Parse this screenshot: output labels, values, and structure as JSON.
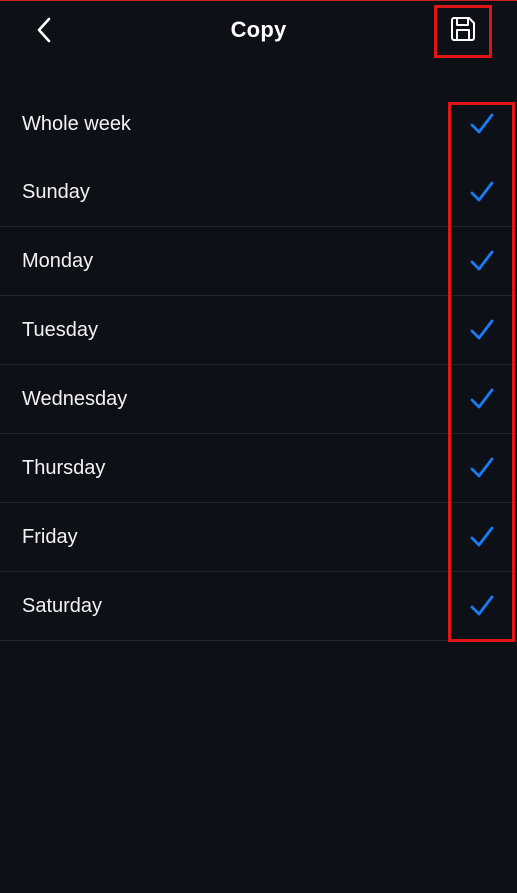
{
  "header": {
    "title": "Copy",
    "back_icon": "chevron-left-icon",
    "save_icon": "floppy-disk-icon"
  },
  "colors": {
    "background": "#0d1117",
    "checkmark": "#1a7cf5",
    "highlight": "#e01616",
    "divider": "#23272e"
  },
  "days": {
    "items": [
      {
        "label": "Whole week",
        "checked": true
      },
      {
        "label": "Sunday",
        "checked": true
      },
      {
        "label": "Monday",
        "checked": true
      },
      {
        "label": "Tuesday",
        "checked": true
      },
      {
        "label": "Wednesday",
        "checked": true
      },
      {
        "label": "Thursday",
        "checked": true
      },
      {
        "label": "Friday",
        "checked": true
      },
      {
        "label": "Saturday",
        "checked": true
      }
    ]
  }
}
